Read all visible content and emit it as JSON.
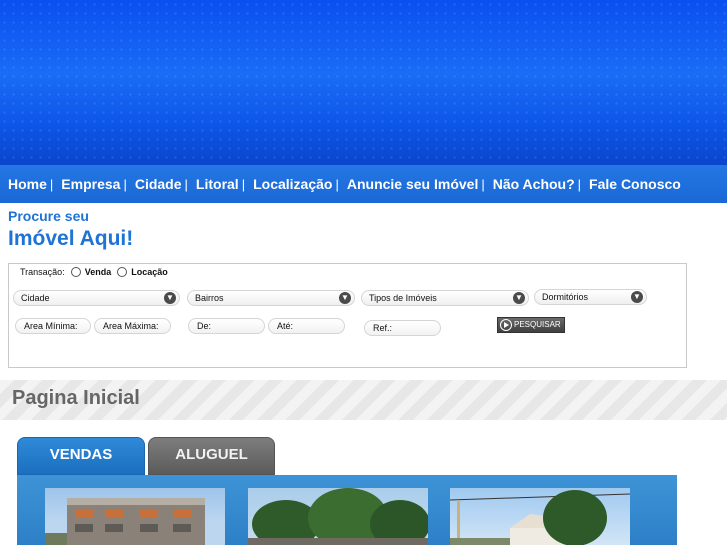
{
  "nav": {
    "items": [
      "Home",
      "Empresa",
      "Cidade",
      "Litoral",
      "Localização",
      "Anuncie seu Imóvel",
      "Não Achou?",
      "Fale Conosco"
    ],
    "separator": "|"
  },
  "search": {
    "subtitle": "Procure seu",
    "title": "Imóvel Aqui!",
    "transacao_label": "Transação:",
    "option_venda": "Venda",
    "option_locacao": "Locação",
    "select_cidade": "Cidade",
    "select_bairros": "Bairros",
    "select_tipos": "Tipos de Imóveis",
    "select_dormitorios": "Dormitórios",
    "area_minima": "Area Mínima:",
    "area_maxima": "Area Máxima:",
    "de": "De:",
    "ate": "Até:",
    "ref": "Ref.:",
    "button": "PESQUISAR"
  },
  "page": {
    "title": "Pagina Inicial"
  },
  "tabs": {
    "vendas": "VENDAS",
    "aluguel": "ALUGUEL"
  },
  "colors": {
    "brand_blue": "#1e74d4",
    "banner_blue": "#0d56e8",
    "tab_active": "#2a82cf",
    "tab_inactive": "#6a6a6a"
  }
}
